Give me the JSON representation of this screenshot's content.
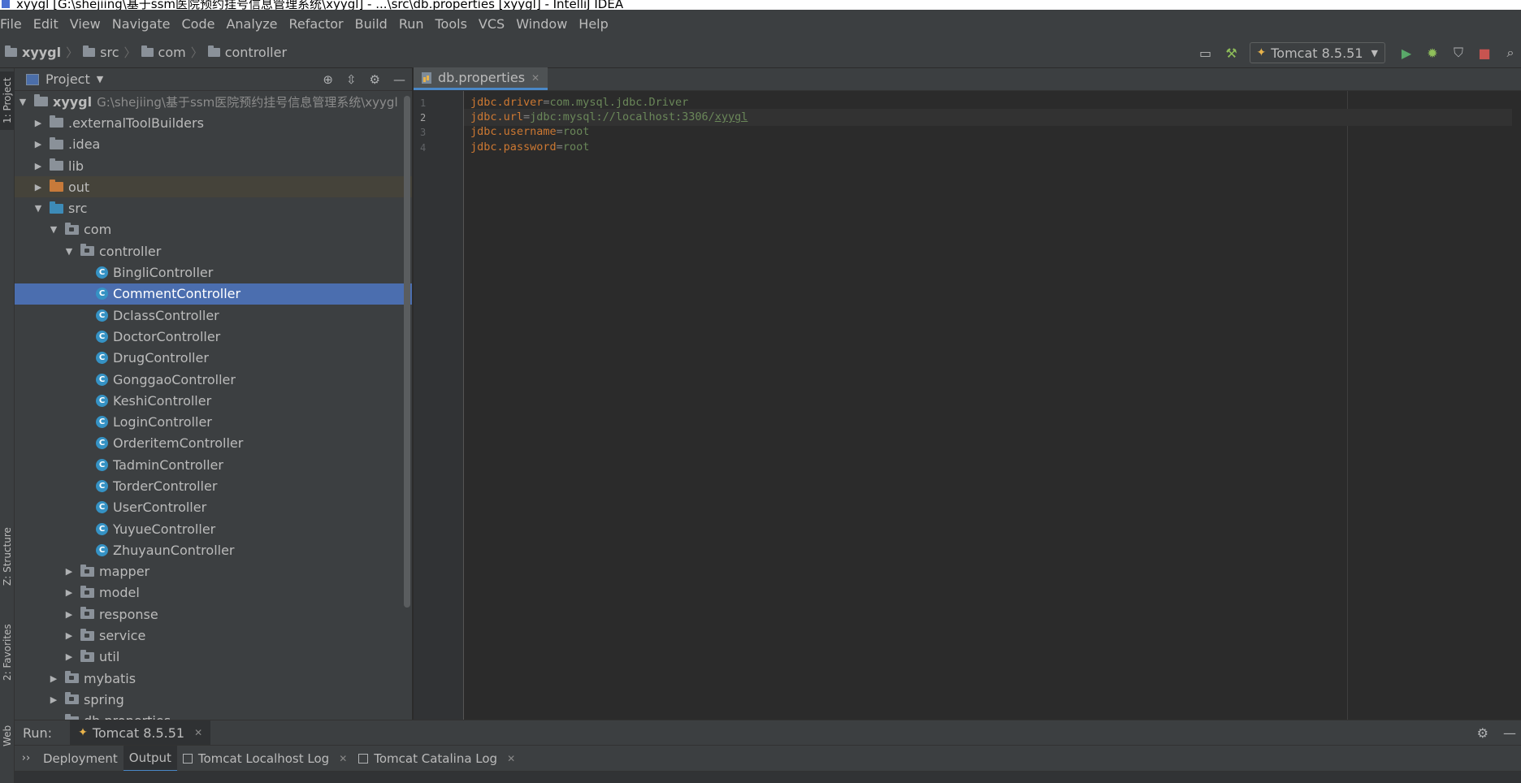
{
  "window": {
    "title": "xyygl [G:\\shejiing\\基于ssm医院预约挂号信息管理系统\\xyygl] - ...\\src\\db.properties [xyygl] - IntelliJ IDEA"
  },
  "menu": [
    "File",
    "Edit",
    "View",
    "Navigate",
    "Code",
    "Analyze",
    "Refactor",
    "Build",
    "Run",
    "Tools",
    "VCS",
    "Window",
    "Help"
  ],
  "breadcrumb": {
    "root": "xyygl",
    "items": [
      "src",
      "com",
      "controller"
    ]
  },
  "toolbar": {
    "run_config": "Tomcat 8.5.51"
  },
  "left_strip": {
    "project_tab": "1: Project",
    "structure_tab": "Z: Structure",
    "favorites_tab": "2: Favorites",
    "web_tab": "Web"
  },
  "project_panel": {
    "title": "Project",
    "root_name": "xyygl",
    "root_path": "G:\\shejiing\\基于ssm医院预约挂号信息管理系统\\xyygl",
    "rows": [
      {
        "label": ".externalToolBuilders",
        "depth": 1,
        "type": "folder",
        "state": "collapsed"
      },
      {
        "label": ".idea",
        "depth": 1,
        "type": "folder",
        "state": "collapsed"
      },
      {
        "label": "lib",
        "depth": 1,
        "type": "folder",
        "state": "collapsed"
      },
      {
        "label": "out",
        "depth": 1,
        "type": "folder-excluded",
        "state": "collapsed"
      },
      {
        "label": "src",
        "depth": 1,
        "type": "folder-source",
        "state": "expanded"
      },
      {
        "label": "com",
        "depth": 2,
        "type": "package",
        "state": "expanded"
      },
      {
        "label": "controller",
        "depth": 3,
        "type": "package",
        "state": "expanded"
      },
      {
        "label": "BingliController",
        "depth": 4,
        "type": "class"
      },
      {
        "label": "CommentController",
        "depth": 4,
        "type": "class",
        "selected": true
      },
      {
        "label": "DclassController",
        "depth": 4,
        "type": "class"
      },
      {
        "label": "DoctorController",
        "depth": 4,
        "type": "class"
      },
      {
        "label": "DrugController",
        "depth": 4,
        "type": "class"
      },
      {
        "label": "GonggaoController",
        "depth": 4,
        "type": "class"
      },
      {
        "label": "KeshiController",
        "depth": 4,
        "type": "class"
      },
      {
        "label": "LoginController",
        "depth": 4,
        "type": "class"
      },
      {
        "label": "OrderitemController",
        "depth": 4,
        "type": "class"
      },
      {
        "label": "TadminController",
        "depth": 4,
        "type": "class"
      },
      {
        "label": "TorderController",
        "depth": 4,
        "type": "class"
      },
      {
        "label": "UserController",
        "depth": 4,
        "type": "class"
      },
      {
        "label": "YuyueController",
        "depth": 4,
        "type": "class"
      },
      {
        "label": "ZhuyaunController",
        "depth": 4,
        "type": "class"
      },
      {
        "label": "mapper",
        "depth": 3,
        "type": "package",
        "state": "collapsed"
      },
      {
        "label": "model",
        "depth": 3,
        "type": "package",
        "state": "collapsed"
      },
      {
        "label": "response",
        "depth": 3,
        "type": "package",
        "state": "collapsed"
      },
      {
        "label": "service",
        "depth": 3,
        "type": "package",
        "state": "collapsed"
      },
      {
        "label": "util",
        "depth": 3,
        "type": "package",
        "state": "collapsed"
      },
      {
        "label": "mybatis",
        "depth": 2,
        "type": "package",
        "state": "collapsed"
      },
      {
        "label": "spring",
        "depth": 2,
        "type": "package",
        "state": "collapsed"
      },
      {
        "label": "db.properties",
        "depth": 2,
        "type": "file"
      }
    ]
  },
  "editor": {
    "tab_label": "db.properties",
    "current_line": 2,
    "lines": [
      {
        "num": "1",
        "key": "jdbc.driver",
        "eq": "=",
        "value": "com.mysql.jdbc.Driver",
        "value_tail": ""
      },
      {
        "num": "2",
        "key": "jdbc.url",
        "eq": "=",
        "value": "jdbc:mysql://localhost:3306/",
        "value_tail": "xyygl"
      },
      {
        "num": "3",
        "key": "jdbc.username",
        "eq": "=",
        "value": "root",
        "value_tail": ""
      },
      {
        "num": "4",
        "key": "jdbc.password",
        "eq": "=",
        "value": "root",
        "value_tail": ""
      }
    ]
  },
  "run_panel": {
    "label": "Run:",
    "config_tab": "Tomcat 8.5.51",
    "sub_tabs": [
      "Deployment",
      "Output",
      "Tomcat Localhost Log",
      "Tomcat Catalina Log"
    ],
    "active_sub_tab": "Output"
  }
}
